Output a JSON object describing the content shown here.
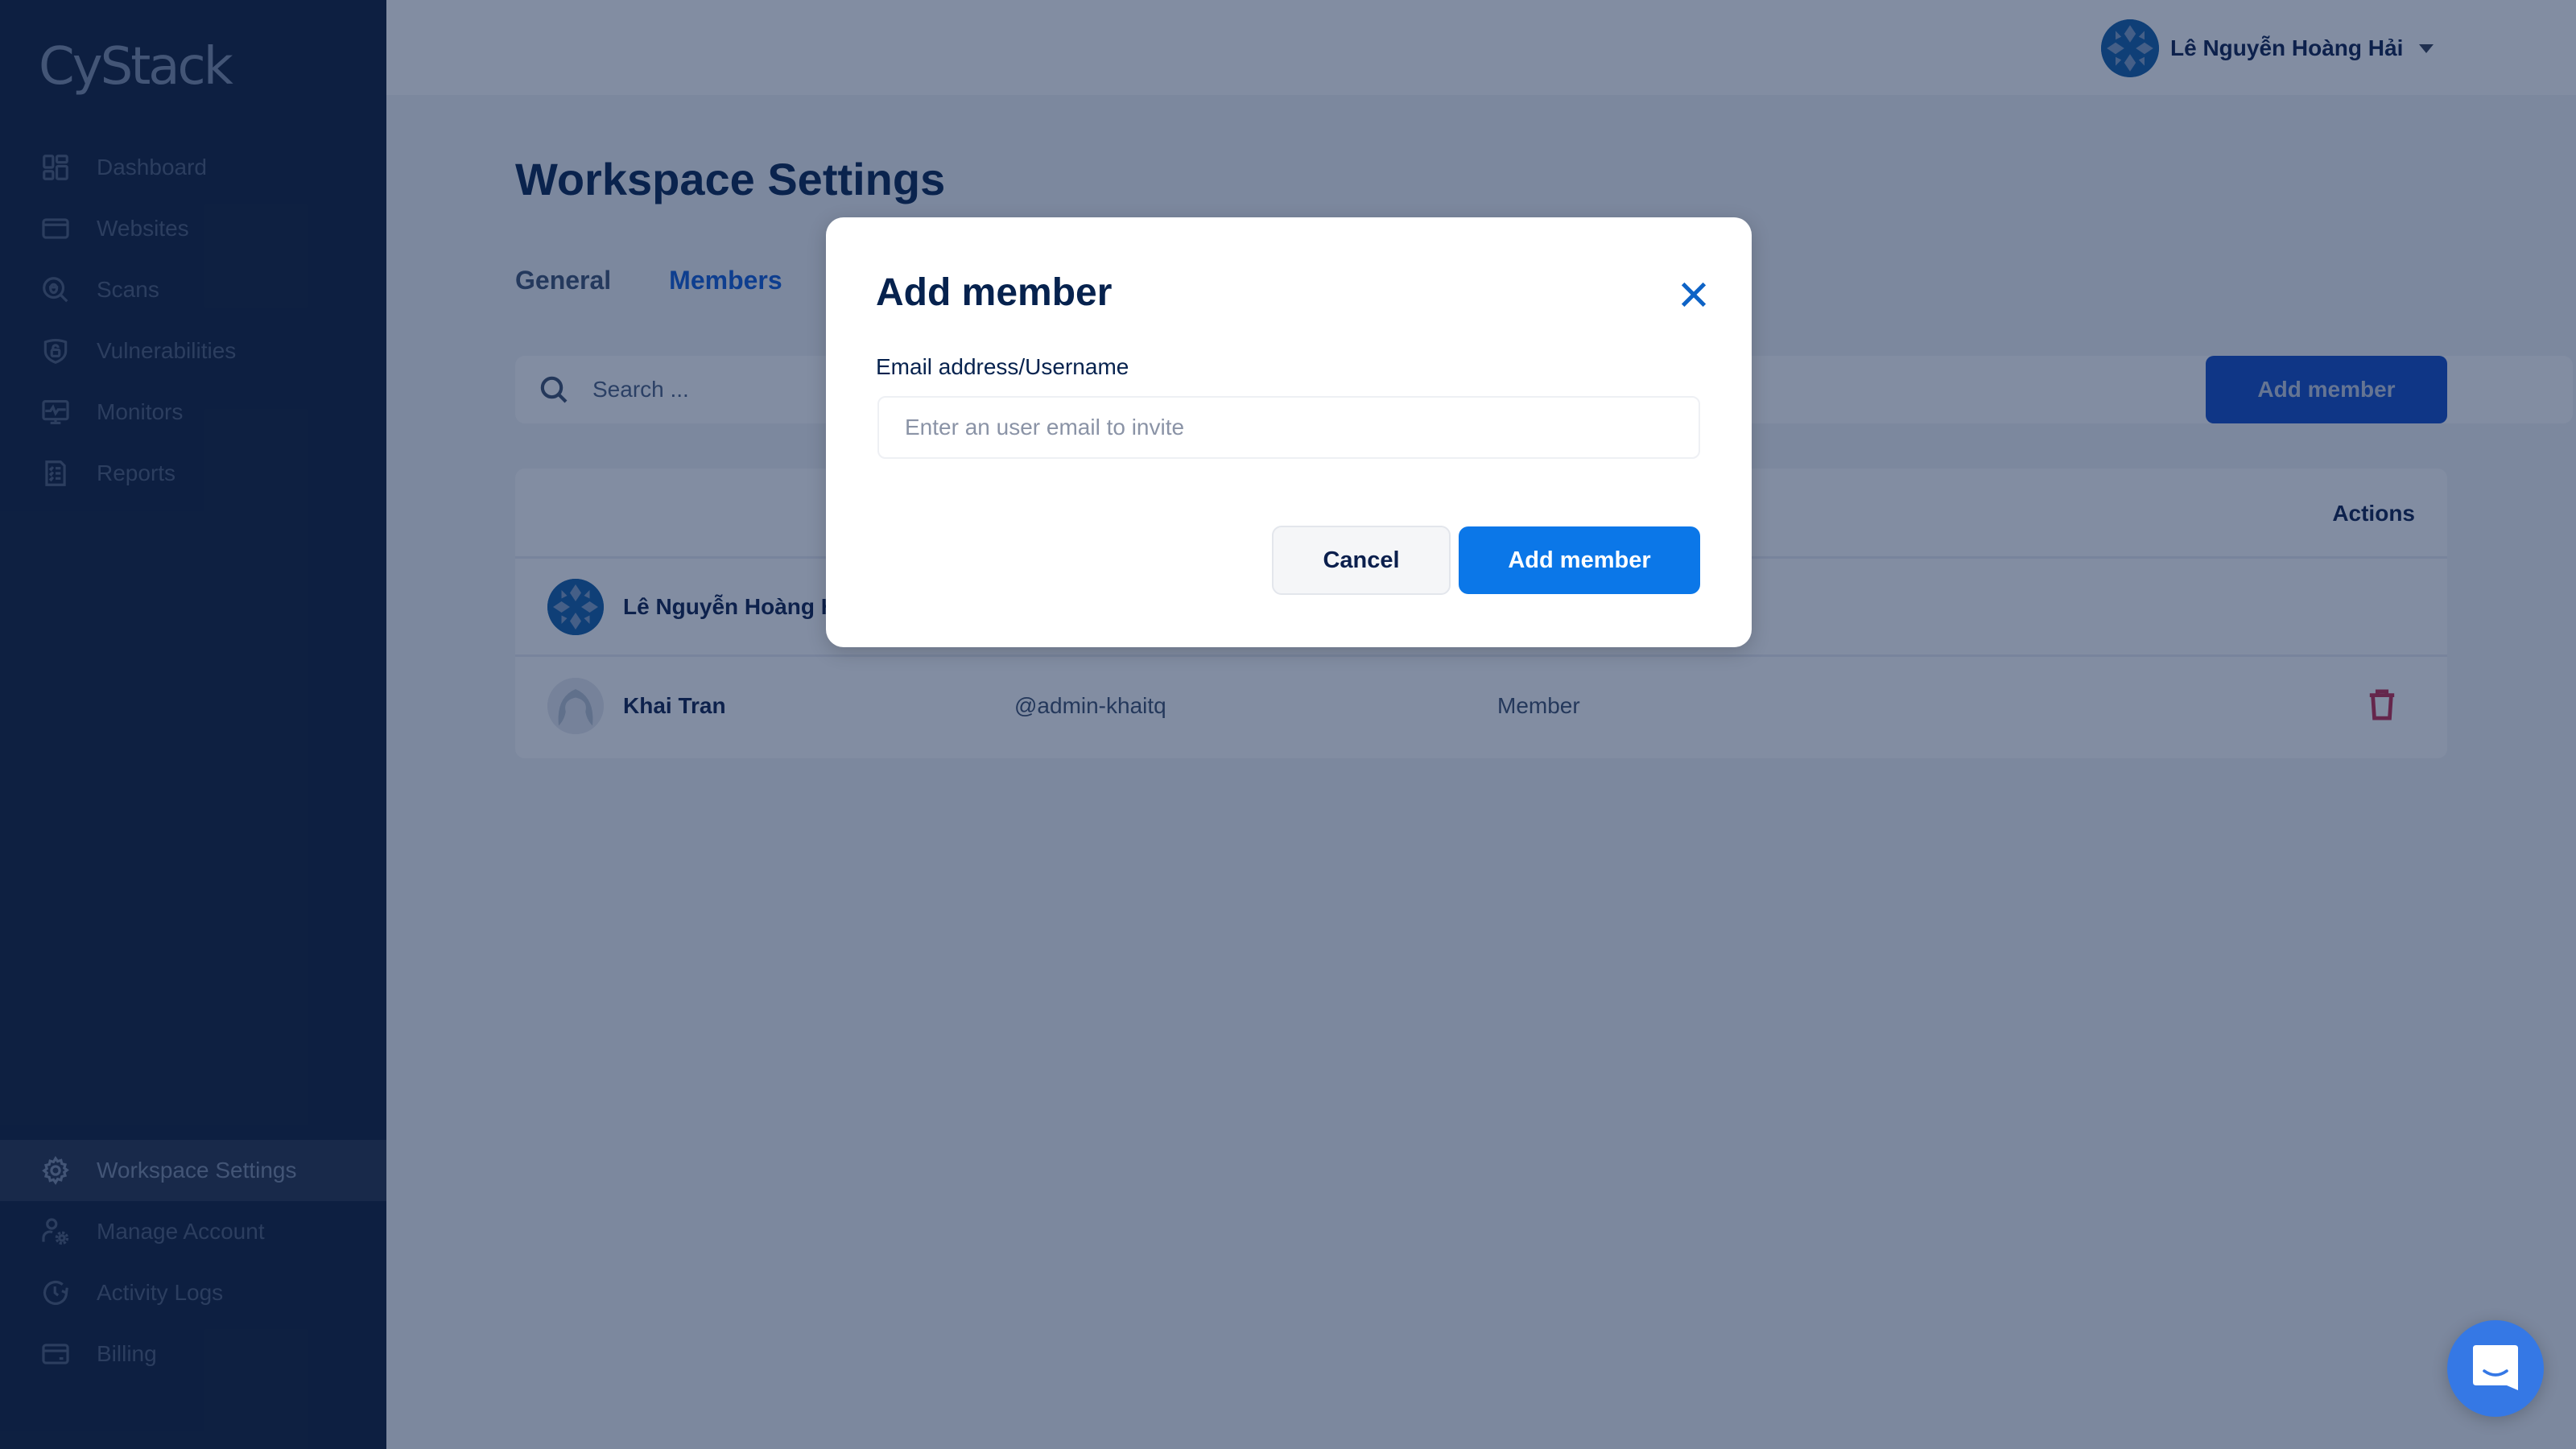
{
  "app": {
    "logo_text": "CyStack"
  },
  "sidebar": {
    "top_items": [
      {
        "label": "Dashboard",
        "icon": "dashboard-icon"
      },
      {
        "label": "Websites",
        "icon": "browser-window-icon"
      },
      {
        "label": "Scans",
        "icon": "bug-search-icon"
      },
      {
        "label": "Vulnerabilities",
        "icon": "shield-lock-icon"
      },
      {
        "label": "Monitors",
        "icon": "monitor-pulse-icon"
      },
      {
        "label": "Reports",
        "icon": "checklist-icon"
      }
    ],
    "bottom_items": [
      {
        "label": "Workspace Settings",
        "icon": "gear-icon",
        "active": true
      },
      {
        "label": "Manage Account",
        "icon": "user-gear-icon"
      },
      {
        "label": "Activity Logs",
        "icon": "clock-history-icon"
      },
      {
        "label": "Billing",
        "icon": "credit-card-icon"
      }
    ]
  },
  "header": {
    "user_name": "Lê Nguyễn Hoàng Hải"
  },
  "page": {
    "title": "Workspace Settings",
    "tabs": [
      {
        "label": "General",
        "active": false
      },
      {
        "label": "Members",
        "active": true
      }
    ],
    "search": {
      "placeholder": "Search ...",
      "value": ""
    },
    "add_member_label": "Add member",
    "table": {
      "headers": {
        "actions": "Actions"
      },
      "rows": [
        {
          "name": "Lê Nguyễn Hoàng Hải",
          "username": "",
          "role": "",
          "avatar": "workspace-avatar"
        },
        {
          "name": "Khai Tran",
          "username": "@admin-khaitq",
          "role": "Member",
          "avatar": "default-avatar"
        }
      ]
    }
  },
  "modal": {
    "title": "Add member",
    "field_label": "Email address/Username",
    "field_placeholder": "Enter an user email to invite",
    "field_value": "",
    "cancel_label": "Cancel",
    "submit_label": "Add member"
  },
  "colors": {
    "sidebar_bg": "#0c1a36",
    "primary": "#0b77e8",
    "title": "#06224e",
    "danger": "#c2284c",
    "chat": "#3578e5"
  }
}
